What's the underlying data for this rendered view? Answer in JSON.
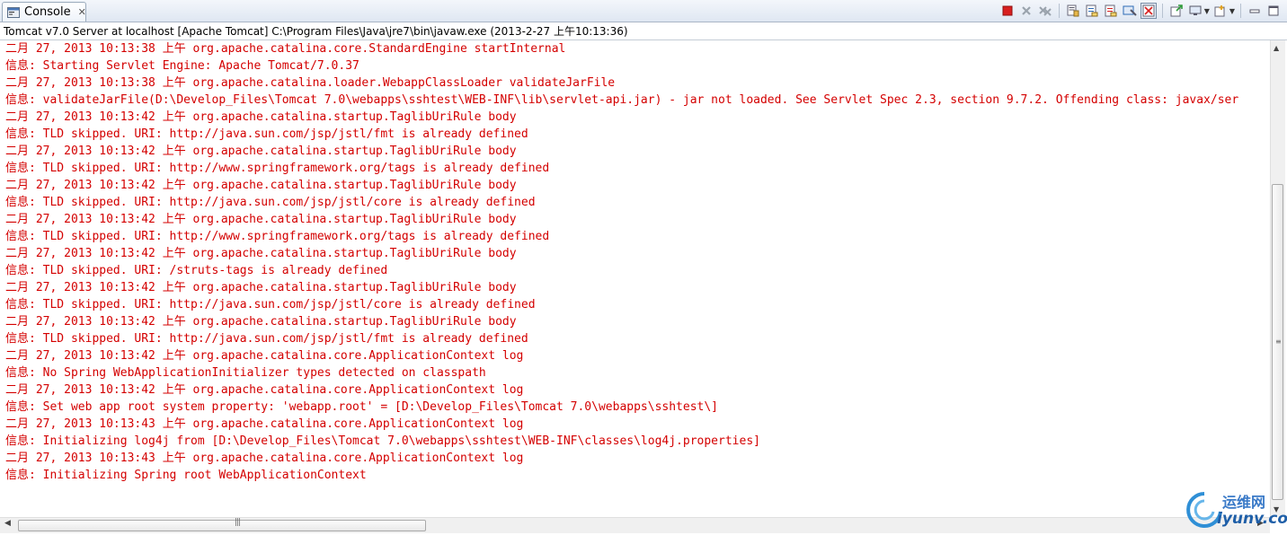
{
  "view": {
    "tab_label": "Console",
    "tab_close": "✕",
    "process_label": "Tomcat v7.0 Server at localhost [Apache Tomcat] C:\\Program Files\\Java\\jre7\\bin\\javaw.exe (2013-2-27 上午10:13:36)"
  },
  "toolbar": {
    "icons": [
      "terminate-icon",
      "remove-launch-icon",
      "remove-all-terminated-icon",
      "scroll-lock-icon",
      "show-on-stdout-icon",
      "show-on-stderr-icon",
      "clear-console-icon",
      "pin-console-icon",
      "display-selected-console-icon",
      "open-console-icon",
      "minimize-icon",
      "maximize-icon"
    ],
    "colors": {
      "terminate": "#d81f1f",
      "disabled": "#9aa3ad",
      "accent": "#2d6bb5"
    }
  },
  "console": {
    "text_color": "#d40000",
    "lines": [
      "二月 27, 2013 10:13:38 上午 org.apache.catalina.core.StandardEngine startInternal",
      "信息: Starting Servlet Engine: Apache Tomcat/7.0.37",
      "二月 27, 2013 10:13:38 上午 org.apache.catalina.loader.WebappClassLoader validateJarFile",
      "信息: validateJarFile(D:\\Develop_Files\\Tomcat 7.0\\webapps\\sshtest\\WEB-INF\\lib\\servlet-api.jar) - jar not loaded. See Servlet Spec 2.3, section 9.7.2. Offending class: javax/ser",
      "二月 27, 2013 10:13:42 上午 org.apache.catalina.startup.TaglibUriRule body",
      "信息: TLD skipped. URI: http://java.sun.com/jsp/jstl/fmt is already defined",
      "二月 27, 2013 10:13:42 上午 org.apache.catalina.startup.TaglibUriRule body",
      "信息: TLD skipped. URI: http://www.springframework.org/tags is already defined",
      "二月 27, 2013 10:13:42 上午 org.apache.catalina.startup.TaglibUriRule body",
      "信息: TLD skipped. URI: http://java.sun.com/jsp/jstl/core is already defined",
      "二月 27, 2013 10:13:42 上午 org.apache.catalina.startup.TaglibUriRule body",
      "信息: TLD skipped. URI: http://www.springframework.org/tags is already defined",
      "二月 27, 2013 10:13:42 上午 org.apache.catalina.startup.TaglibUriRule body",
      "信息: TLD skipped. URI: /struts-tags is already defined",
      "二月 27, 2013 10:13:42 上午 org.apache.catalina.startup.TaglibUriRule body",
      "信息: TLD skipped. URI: http://java.sun.com/jsp/jstl/core is already defined",
      "二月 27, 2013 10:13:42 上午 org.apache.catalina.startup.TaglibUriRule body",
      "信息: TLD skipped. URI: http://java.sun.com/jsp/jstl/fmt is already defined",
      "二月 27, 2013 10:13:42 上午 org.apache.catalina.core.ApplicationContext log",
      "信息: No Spring WebApplicationInitializer types detected on classpath",
      "二月 27, 2013 10:13:42 上午 org.apache.catalina.core.ApplicationContext log",
      "信息: Set web app root system property: 'webapp.root' = [D:\\Develop_Files\\Tomcat 7.0\\webapps\\sshtest\\]",
      "二月 27, 2013 10:13:43 上午 org.apache.catalina.core.ApplicationContext log",
      "信息: Initializing log4j from [D:\\Develop_Files\\Tomcat 7.0\\webapps\\sshtest\\WEB-INF\\classes\\log4j.properties]",
      "二月 27, 2013 10:13:43 上午 org.apache.catalina.core.ApplicationContext log",
      "信息: Initializing Spring root WebApplicationContext"
    ]
  },
  "watermark": {
    "cn": "运维网",
    "en": "iyunv.com"
  }
}
